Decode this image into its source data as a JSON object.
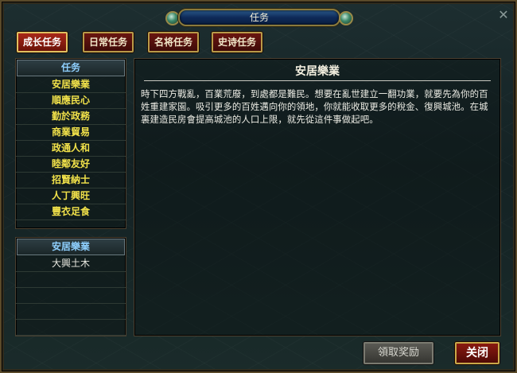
{
  "window": {
    "title": "任务",
    "close_glyph": "✕"
  },
  "tabs": [
    {
      "label": "成长任务",
      "active": true
    },
    {
      "label": "日常任务",
      "active": false
    },
    {
      "label": "名将任务",
      "active": false
    },
    {
      "label": "史诗任务",
      "active": false
    }
  ],
  "quest_panel": {
    "header": "任务",
    "items": [
      "安居樂業",
      "順應民心",
      "勤於政務",
      "商業貿易",
      "政通人和",
      "睦鄰友好",
      "招賢納士",
      "人丁興旺",
      "豐衣足食"
    ]
  },
  "sub_panel": {
    "header": "安居樂業",
    "items": [
      "大興土木"
    ]
  },
  "content": {
    "title": "安居樂業",
    "body": "時下四方戰亂，百業荒廢，到處都是難民。想要在亂世建立一翻功業，就要先為你的百姓重建家園。吸引更多的百姓邁向你的領地，你就能收取更多的稅金、復興城池。在城裏建造民房會提高城池的人口上限，就先從這件事做起吧。"
  },
  "buttons": {
    "claim_reward": "領取奖励",
    "close": "关闭"
  },
  "colors": {
    "quest_text": "#f2e24a",
    "header_text": "#8fd0ff",
    "tab_red": "#6a1610",
    "gold_border": "#b89a48"
  }
}
